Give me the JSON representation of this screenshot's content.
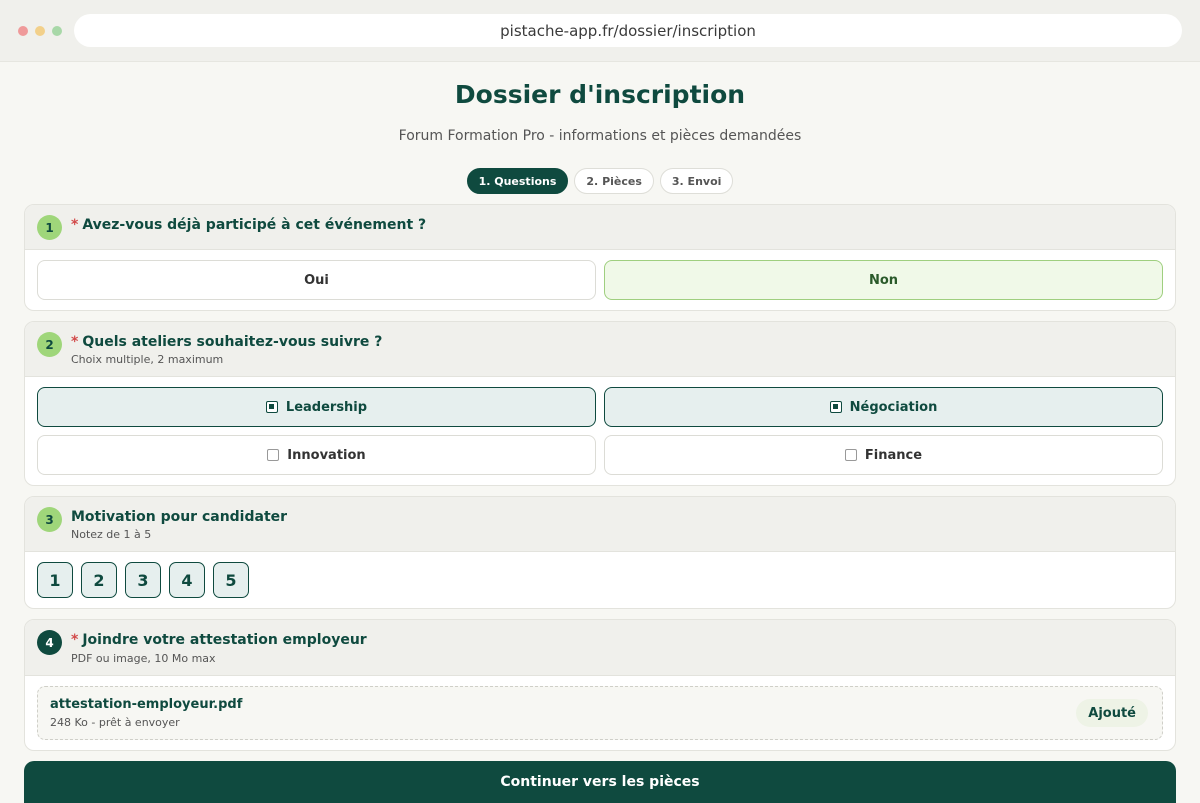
{
  "browser": {
    "url": "pistache-app.fr/dossier/inscription"
  },
  "header": {
    "title": "Dossier d'inscription",
    "subtitle": "Forum Formation Pro - informations et pièces demandées"
  },
  "steps": [
    {
      "label": "1. Questions",
      "active": true
    },
    {
      "label": "2. Pièces",
      "active": false
    },
    {
      "label": "3. Envoi",
      "active": false
    }
  ],
  "q1": {
    "number": "1",
    "required_mark": "*",
    "title": "Avez-vous déjà participé à cet événement ?",
    "options": [
      {
        "label": "Oui",
        "selected": false
      },
      {
        "label": "Non",
        "selected": true
      }
    ]
  },
  "q2": {
    "number": "2",
    "required_mark": "*",
    "title": "Quels ateliers souhaitez-vous suivre ?",
    "hint": "Choix multiple, 2 maximum",
    "options": [
      {
        "label": "Leadership",
        "checked": true
      },
      {
        "label": "Négociation",
        "checked": true
      },
      {
        "label": "Innovation",
        "checked": false
      },
      {
        "label": "Finance",
        "checked": false
      }
    ]
  },
  "q3": {
    "number": "3",
    "title": "Motivation pour candidater",
    "hint": "Notez de 1 à 5",
    "ratings": [
      "1",
      "2",
      "3",
      "4",
      "5"
    ]
  },
  "q4": {
    "number": "4",
    "required_mark": "*",
    "title": "Joindre votre attestation employeur",
    "hint": "PDF ou image, 10 Mo max",
    "file": {
      "name": "attestation-employeur.pdf",
      "meta": "248 Ko - prêt à envoyer",
      "status": "Ajouté"
    }
  },
  "cta": {
    "label": "Continuer vers les pièces"
  },
  "colors": {
    "brand": "#0f4a3f",
    "accent_green": "#9fd67a",
    "required": "#d24a4a"
  }
}
